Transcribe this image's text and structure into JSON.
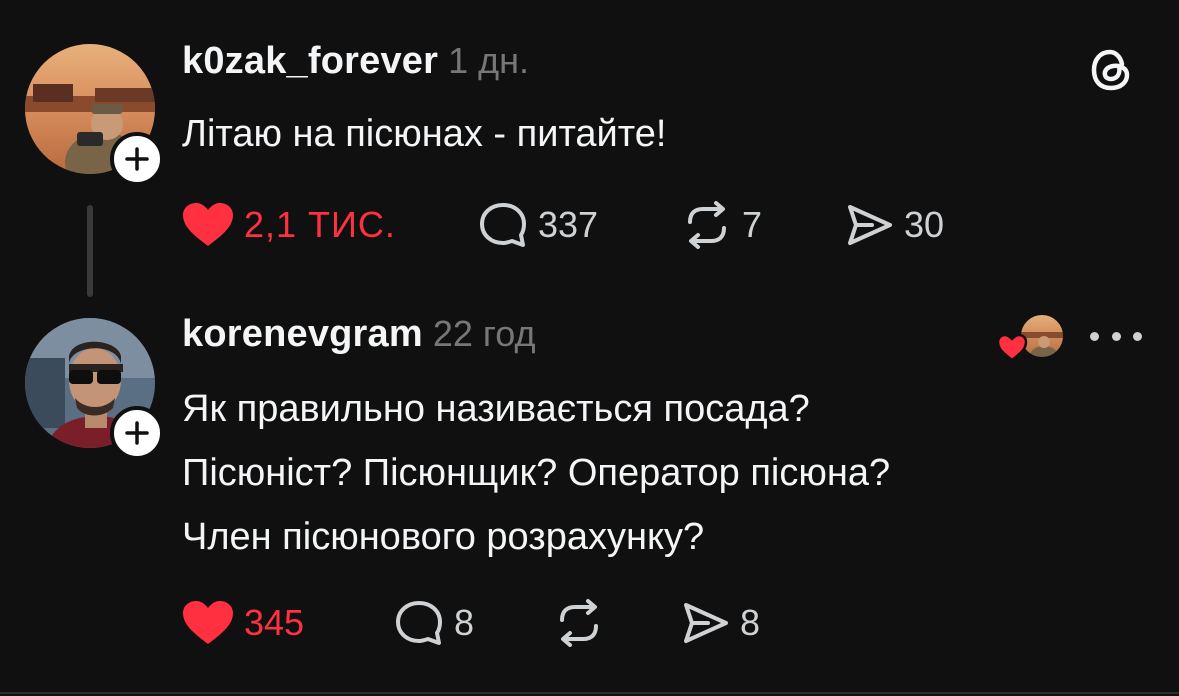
{
  "posts": [
    {
      "username": "k0zak_forever",
      "time": "1 дн.",
      "text_lines": [
        "Літаю на пісюнах - питайте!"
      ],
      "likes": "2,1 тис.",
      "comments": "337",
      "reposts": "7",
      "shares": "30"
    },
    {
      "username": "korenevgram",
      "time": "22 год",
      "text_lines": [
        "Як правильно називається посада?",
        "Пісюніст? Пісюнщик? Оператор пісюна?",
        "Член пісюнового розрахунку?"
      ],
      "likes": "345",
      "comments": "8",
      "reposts": "",
      "shares": "8"
    }
  ],
  "icons": {
    "app_logo": "threads-logo-icon",
    "more": "more-options-icon",
    "like": "heart-icon",
    "comment": "comment-icon",
    "repost": "repost-icon",
    "share": "share-icon",
    "follow": "plus-icon"
  },
  "colors": {
    "background": "#101010",
    "like_red": "#ff3040",
    "text": "#f3f5f7",
    "muted": "#777777"
  }
}
